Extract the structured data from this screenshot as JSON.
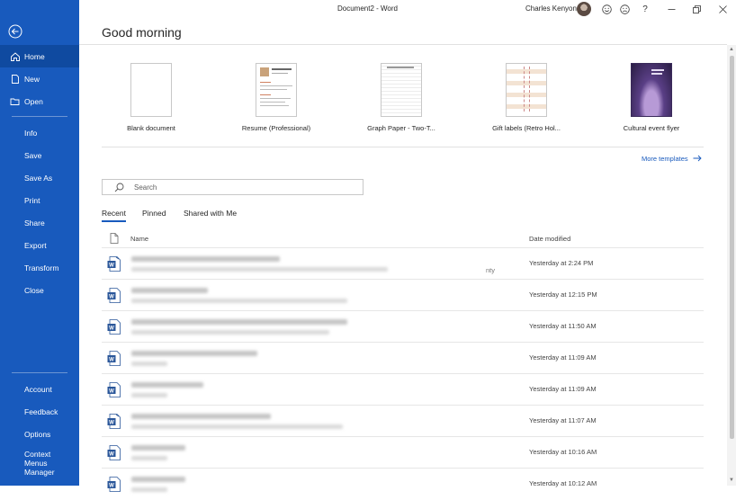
{
  "titlebar": {
    "document_title": "Document2  -  Word",
    "user_name": "Charles Kenyon"
  },
  "sidebar": {
    "items_top": [
      {
        "label": "Home",
        "icon": "home-icon",
        "active": true
      },
      {
        "label": "New",
        "icon": "new-document-icon"
      },
      {
        "label": "Open",
        "icon": "folder-open-icon"
      }
    ],
    "items_mid": [
      "Info",
      "Save",
      "Save As",
      "Print",
      "Share",
      "Export",
      "Transform",
      "Close"
    ],
    "items_bottom": [
      "Account",
      "Feedback",
      "Options",
      "Context Menus Manager"
    ]
  },
  "main": {
    "greeting": "Good morning",
    "templates": [
      {
        "name": "Blank document"
      },
      {
        "name": "Resume (Professional)"
      },
      {
        "name": "Graph Paper - Two-T..."
      },
      {
        "name": "Gift labels (Retro Hol..."
      },
      {
        "name": "Cultural event flyer"
      }
    ],
    "more_templates": "More templates",
    "search_placeholder": "Search",
    "tabs": [
      "Recent",
      "Pinned",
      "Shared with Me"
    ],
    "columns": {
      "name": "Name",
      "date": "Date modified"
    },
    "files": [
      {
        "date": "Yesterday at 2:24 PM",
        "trailing": "nty"
      },
      {
        "date": "Yesterday at 12:15 PM"
      },
      {
        "date": "Yesterday at 11:50 AM"
      },
      {
        "date": "Yesterday at 11:09 AM"
      },
      {
        "date": "Yesterday at 11:09 AM"
      },
      {
        "date": "Yesterday at 11:07 AM"
      },
      {
        "date": "Yesterday at 10:16 AM"
      },
      {
        "date": "Yesterday at 10:12 AM"
      }
    ]
  },
  "colors": {
    "accent": "#185abd",
    "sidebar_active": "#0f4aa0"
  }
}
